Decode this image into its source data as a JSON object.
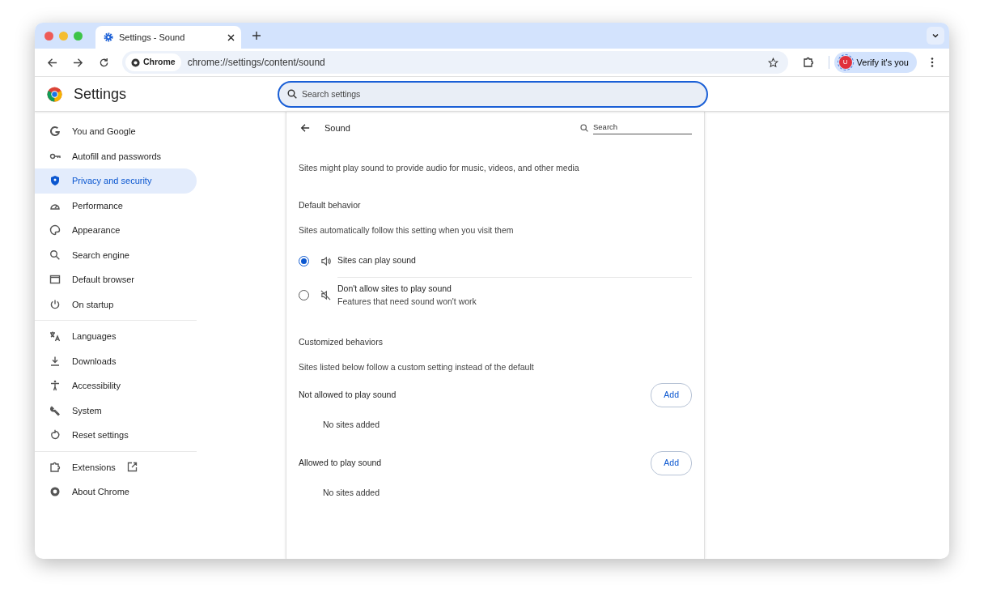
{
  "tab": {
    "title": "Settings - Sound",
    "selected": true
  },
  "toolbar": {
    "chip": "Chrome",
    "url": "chrome://settings/content/sound",
    "profile_initial": "U",
    "profile_label": "Verify it's you"
  },
  "header": {
    "title": "Settings",
    "search_placeholder": "Search settings"
  },
  "sidebar": {
    "groups": [
      [
        {
          "label": "You and Google",
          "selected": false
        },
        {
          "label": "Autofill and passwords",
          "selected": false
        },
        {
          "label": "Privacy and security",
          "selected": true
        },
        {
          "label": "Performance",
          "selected": false
        },
        {
          "label": "Appearance",
          "selected": false
        },
        {
          "label": "Search engine",
          "selected": false
        },
        {
          "label": "Default browser",
          "selected": false
        },
        {
          "label": "On startup",
          "selected": false
        }
      ],
      [
        {
          "label": "Languages",
          "selected": false
        },
        {
          "label": "Downloads",
          "selected": false
        },
        {
          "label": "Accessibility",
          "selected": false
        },
        {
          "label": "System",
          "selected": false
        },
        {
          "label": "Reset settings",
          "selected": false
        }
      ],
      [
        {
          "label": "Extensions",
          "selected": false
        },
        {
          "label": "About Chrome",
          "selected": false
        }
      ]
    ]
  },
  "page": {
    "title": "Sound",
    "search_placeholder": "Search",
    "description": "Sites might play sound to provide audio for music, videos, and other media",
    "default_heading": "Default behavior",
    "default_sub": "Sites automatically follow this setting when you visit them",
    "options": [
      {
        "label": "Sites can play sound",
        "selected": true
      },
      {
        "label": "Don't allow sites to play sound",
        "sub": "Features that need sound won't work",
        "selected": false
      }
    ],
    "custom_heading": "Customized behaviors",
    "custom_sub": "Sites listed below follow a custom setting instead of the default",
    "lists": [
      {
        "label": "Not allowed to play sound",
        "button": "Add",
        "empty": "No sites added"
      },
      {
        "label": "Allowed to play sound",
        "button": "Add",
        "empty": "No sites added"
      }
    ]
  }
}
